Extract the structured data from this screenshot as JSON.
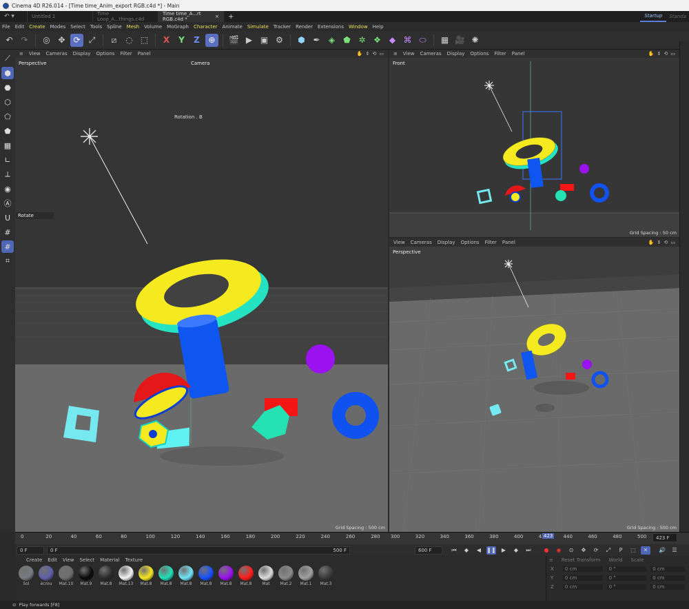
{
  "window": {
    "title": "Cinema 4D R26.014 - [Time time_Anim_export RGB.c4d *] - Main"
  },
  "tabs": [
    {
      "label": "Untitled 1"
    },
    {
      "label": "Time Loop_A...things.c4d"
    },
    {
      "label": "Time time_A...rt RGB.c4d *"
    }
  ],
  "layouts": {
    "active": "Startup",
    "other": "Standa"
  },
  "menu": [
    "File",
    "Edit",
    "Create",
    "Modes",
    "Select",
    "Tools",
    "Spline",
    "Mesh",
    "Volume",
    "MoGraph",
    "Character",
    "Animate",
    "Simulate",
    "Tracker",
    "Render",
    "Extensions",
    "Window",
    "Help"
  ],
  "menu_highlighted": [
    "Create",
    "Mesh",
    "Character",
    "Simulate",
    "Window"
  ],
  "toolbar_axes": {
    "x": "X",
    "y": "Y",
    "z": "Z"
  },
  "viewport_menu": [
    "View",
    "Cameras",
    "Display",
    "Options",
    "Filter",
    "Panel"
  ],
  "viewports": {
    "main": {
      "label": "Perspective",
      "camera": "Camera",
      "hud_rotation": "Rotation . B",
      "hud_rotate": "Rotate",
      "grid": "Grid Spacing : 500 cm"
    },
    "front": {
      "label": "Front",
      "grid": "Grid Spacing : 50 cm"
    },
    "persp2": {
      "label": "Perspective",
      "grid": "Grid Spacing : 500 cm"
    }
  },
  "timeline": {
    "ticks_left": [
      "0",
      "20",
      "40",
      "60",
      "80",
      "100",
      "120",
      "140",
      "160",
      "180",
      "200",
      "220",
      "240",
      "260",
      "280"
    ],
    "ticks_right": [
      "300",
      "320",
      "340",
      "360",
      "380",
      "400",
      "420",
      "440",
      "460",
      "480",
      "500"
    ],
    "current_marker": "423",
    "current_frame": "423 F",
    "start_frame": "0 F",
    "min_frame": "0 F",
    "max_frame": "500 F",
    "end_frame": "600 F"
  },
  "material_menu": [
    "Create",
    "Edit",
    "View",
    "Select",
    "Material",
    "Texture"
  ],
  "materials": [
    {
      "name": "Sol",
      "color": "#777b80"
    },
    {
      "name": "écrou",
      "color": "#5f5fa8"
    },
    {
      "name": "Mat.10",
      "color": "#6e6e6e"
    },
    {
      "name": "Mat.9",
      "color": "#0a0a0a"
    },
    {
      "name": "Mat.8",
      "color": "#2c2c2c"
    },
    {
      "name": "Mat.13",
      "color": "#f2f2f2"
    },
    {
      "name": "Mat.8",
      "color": "#f5e622"
    },
    {
      "name": "Mat.8",
      "color": "#20e0b8"
    },
    {
      "name": "Mat.8",
      "color": "#6fe3f5"
    },
    {
      "name": "Mat.8",
      "color": "#1750ff"
    },
    {
      "name": "Mat.8",
      "color": "#9b10f0"
    },
    {
      "name": "Mat.8",
      "color": "#ff1d1d"
    },
    {
      "name": "Mat",
      "color": "#dcdcdc"
    },
    {
      "name": "Mat.2",
      "color": "#8a8a8a"
    },
    {
      "name": "Mat.1",
      "color": "#a0a0a0"
    },
    {
      "name": "Mat.3",
      "color": "#3a3a3a"
    }
  ],
  "attributes": {
    "header": [
      "Reset Transform",
      "World",
      "Scale"
    ],
    "rows": [
      {
        "axis": "X",
        "pos": "0 cm",
        "rot": "0 °",
        "scale": "0 cm"
      },
      {
        "axis": "Y",
        "pos": "0 cm",
        "rot": "0 °",
        "scale": "0 cm"
      },
      {
        "axis": "Z",
        "pos": "0 cm",
        "rot": "0 °",
        "scale": "0 cm"
      }
    ]
  },
  "status": "Play forwards [F8]"
}
